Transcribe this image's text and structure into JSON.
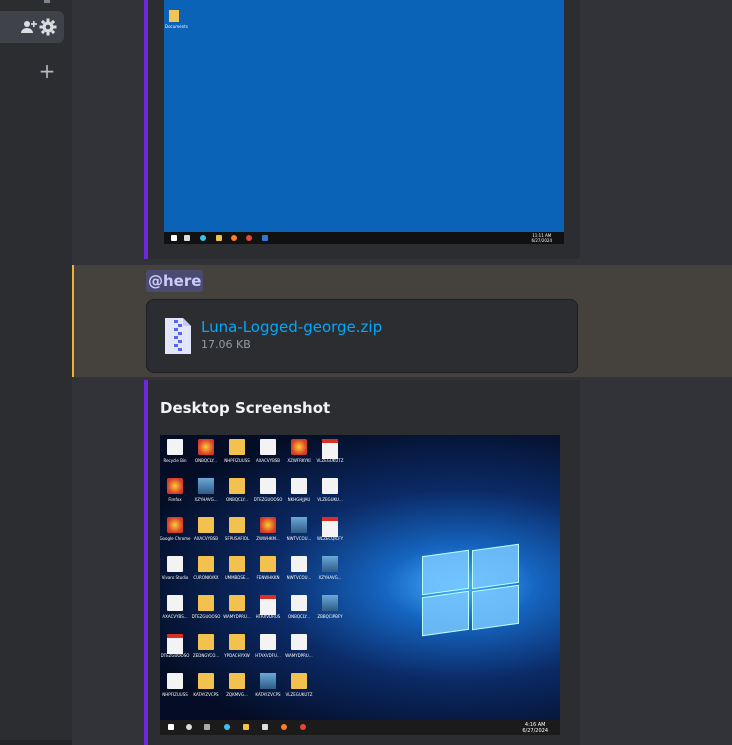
{
  "sidebar": {
    "icons": [
      "add-member-icon",
      "gear-icon",
      "plus-icon"
    ]
  },
  "mention": {
    "text": "@here"
  },
  "attachment": {
    "file_name": "Luna-Logged-george.zip",
    "file_size": "17.06 KB"
  },
  "embed2": {
    "title": "Desktop Screenshot"
  },
  "shot1": {
    "desktop_icon": "Documents",
    "clock": [
      "11:11 AM",
      "6/27/2024"
    ]
  },
  "shot2": {
    "clock": [
      "4:16 AM",
      "6/27/2024"
    ],
    "icons": [
      [
        "Recycle Bin",
        "ONBQCLY...",
        "NHPFIZUUSS",
        "AXACVYBSB",
        "XZWFRKYKI",
        "VLZEGUKUTZ"
      ],
      [
        "Firefox",
        "XZYHAVG...",
        "ONBQCLY...",
        "DTEZGUOOSO",
        "NKHGHJJAU",
        "VLZEGUKU..."
      ],
      [
        "Google Chrome",
        "AXACVYBSB",
        "SFPUSAFIOL",
        "ZWWHKM...",
        "NWTVCOU...",
        "WLZECQICFY"
      ],
      [
        "Vivaro Studio",
        "CURONKVKX",
        "UMMBDSE...",
        "FENWHKKN",
        "NWTVCOU...",
        "XZYHAVG..."
      ],
      [
        "AXACVYBS...",
        "DTEZGUOOSO",
        "WAMYDPRU...",
        "HTAXVDRUS",
        "ONBQCLY...",
        "ZBBQCIPBFY"
      ],
      [
        "DTEZGUOOSO",
        "ZEDNGYCO...",
        "YPDACHYXW",
        "HTAXVDFU...",
        "WAMYDPRU..."
      ],
      [
        "NHPFIZUUSS",
        "KATAYZVCPS",
        "ZQKMVG...",
        "KATAYZVCPS",
        "VLZEGUKUTZ"
      ]
    ]
  }
}
